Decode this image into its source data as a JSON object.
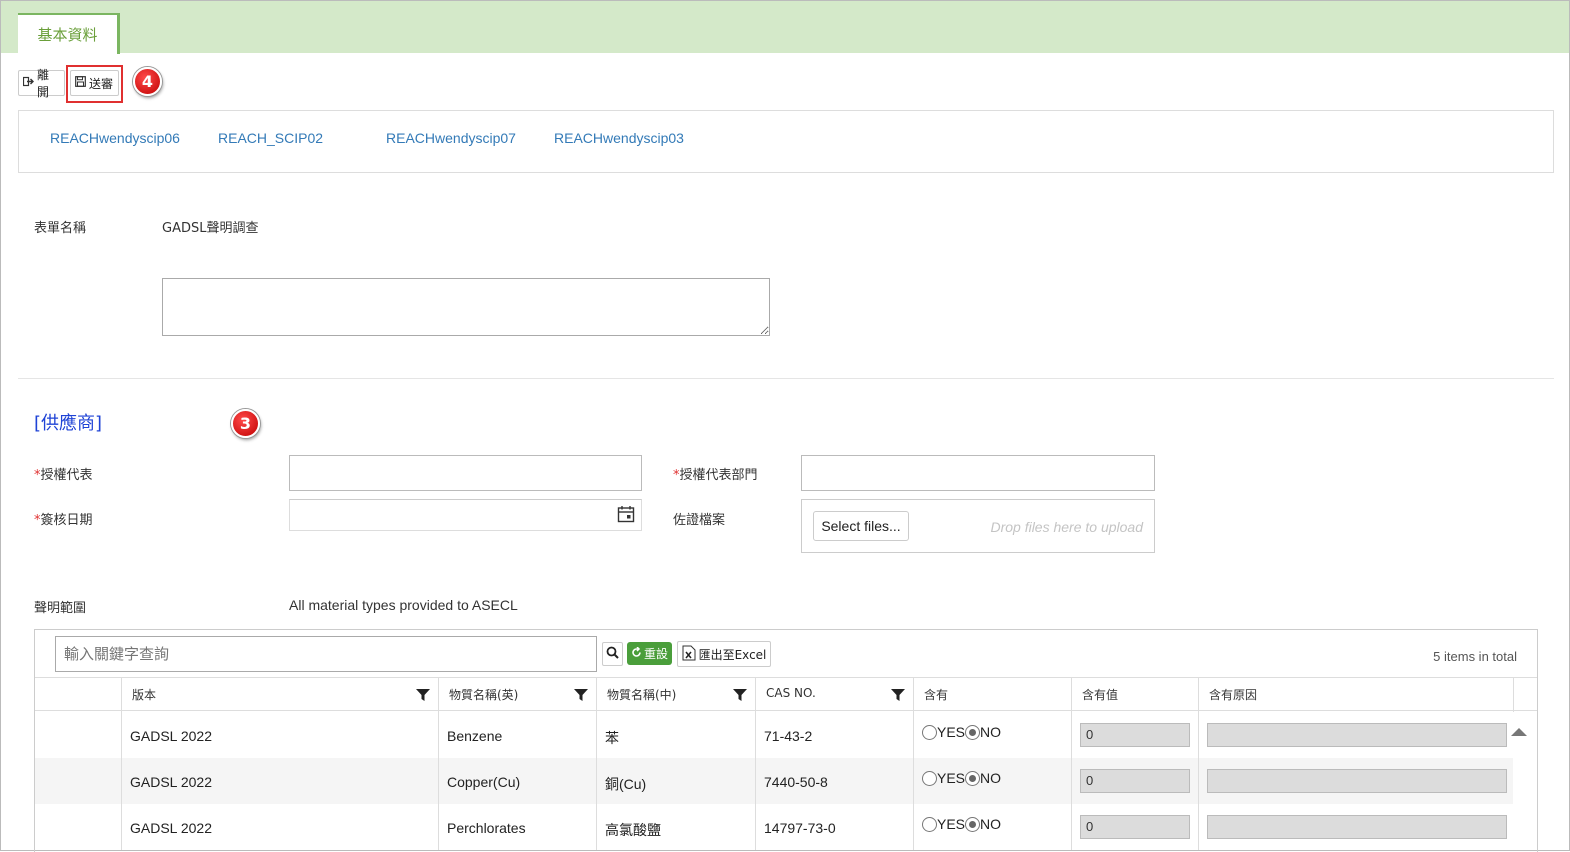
{
  "tabs": {
    "active_label": "基本資料"
  },
  "toolbar": {
    "leave_label": "離開",
    "submit_label": "送審"
  },
  "callouts": {
    "submit_marker": "4",
    "supplier_marker": "3"
  },
  "form_links": [
    "REACHwendyscip06",
    "REACH_SCIP02",
    "REACHwendyscip07",
    "REACHwendyscip03"
  ],
  "form_name": {
    "label": "表單名稱",
    "value": "GADSL聲明調查"
  },
  "supplier": {
    "section_title": "[供應商]",
    "auth_rep_label": "授權代表",
    "auth_dept_label": "授權代表部門",
    "sign_date_label": "簽核日期",
    "evidence_label": "佐證檔案",
    "select_files": "Select files...",
    "drop_hint": "Drop files here to upload",
    "required_mark": "*"
  },
  "scope": {
    "label": "聲明範圍",
    "value": "All material types provided to ASECL"
  },
  "grid": {
    "search_placeholder": "輸入關鍵字查詢",
    "reset_label": "重設",
    "export_label": "匯出至Excel",
    "total_text": "5 items in total",
    "columns": [
      "版本",
      "物質名稱(英)",
      "物質名稱(中)",
      "CAS NO.",
      "含有",
      "含有值",
      "含有原因"
    ],
    "yes_label": "YES",
    "no_label": "NO",
    "rows": [
      {
        "version": "GADSL 2022",
        "name_en": "Benzene",
        "name_zh": "苯",
        "cas": "71-43-2",
        "value": "0",
        "reason": ""
      },
      {
        "version": "GADSL 2022",
        "name_en": "Copper(Cu)",
        "name_zh": "銅(Cu)",
        "cas": "7440-50-8",
        "value": "0",
        "reason": ""
      },
      {
        "version": "GADSL 2022",
        "name_en": "Perchlorates",
        "name_zh": "高氯酸鹽",
        "cas": "14797-73-0",
        "value": "0",
        "reason": ""
      }
    ]
  },
  "colors": {
    "topbar": "#d4e9c9",
    "tab_accent": "#7bb661",
    "link": "#337ab7",
    "section_title": "#1f43d6",
    "callout": "#d10000",
    "reset_button": "#4a9e3b"
  }
}
